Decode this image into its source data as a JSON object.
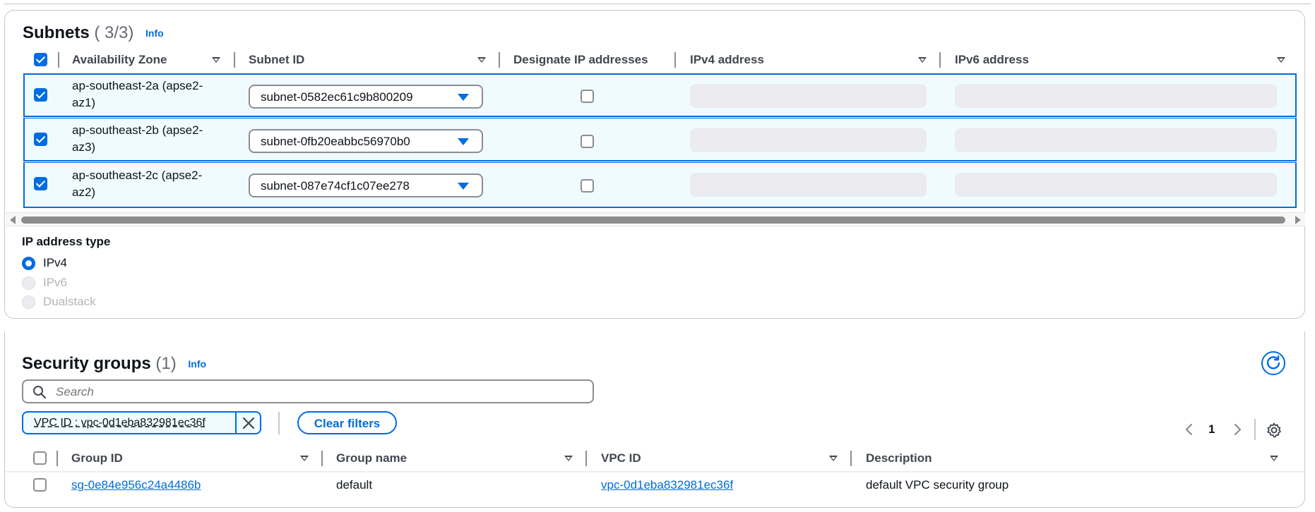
{
  "subnets": {
    "title": "Subnets",
    "count": "( 3/3)",
    "info": "Info",
    "columns": {
      "availability_zone": "Availability Zone",
      "subnet_id": "Subnet ID",
      "designate_ip": "Designate IP addresses",
      "ipv4": "IPv4 address",
      "ipv6": "IPv6 address"
    },
    "rows": [
      {
        "az": "ap-southeast-2a (apse2-az1)",
        "subnet": "subnet-0582ec61c9b800209",
        "checked": true
      },
      {
        "az": "ap-southeast-2b (apse2-az3)",
        "subnet": "subnet-0fb20eabbc56970b0",
        "checked": true
      },
      {
        "az": "ap-southeast-2c (apse2-az2)",
        "subnet": "subnet-087e74cf1c07ee278",
        "checked": true
      }
    ]
  },
  "ip_address_type": {
    "label": "IP address type",
    "options": [
      "IPv4",
      "IPv6",
      "Dualstack"
    ],
    "selected": "IPv4"
  },
  "security_groups": {
    "title": "Security groups",
    "count": "(1)",
    "info": "Info",
    "search_placeholder": "Search",
    "filter_token": "VPC ID : vpc-0d1eba832981ec36f",
    "clear_filters": "Clear filters",
    "page": "1",
    "columns": {
      "group_id": "Group ID",
      "group_name": "Group name",
      "vpc_id": "VPC ID",
      "description": "Description"
    },
    "rows": [
      {
        "group_id": "sg-0e84e956c24a4486b",
        "group_name": "default",
        "vpc_id": "vpc-0d1eba832981ec36f",
        "description": "default VPC security group"
      }
    ]
  },
  "colors": {
    "accent": "#006ce0",
    "row_selected_bg": "#f0fbff",
    "placeholder": "#ebebf0"
  }
}
